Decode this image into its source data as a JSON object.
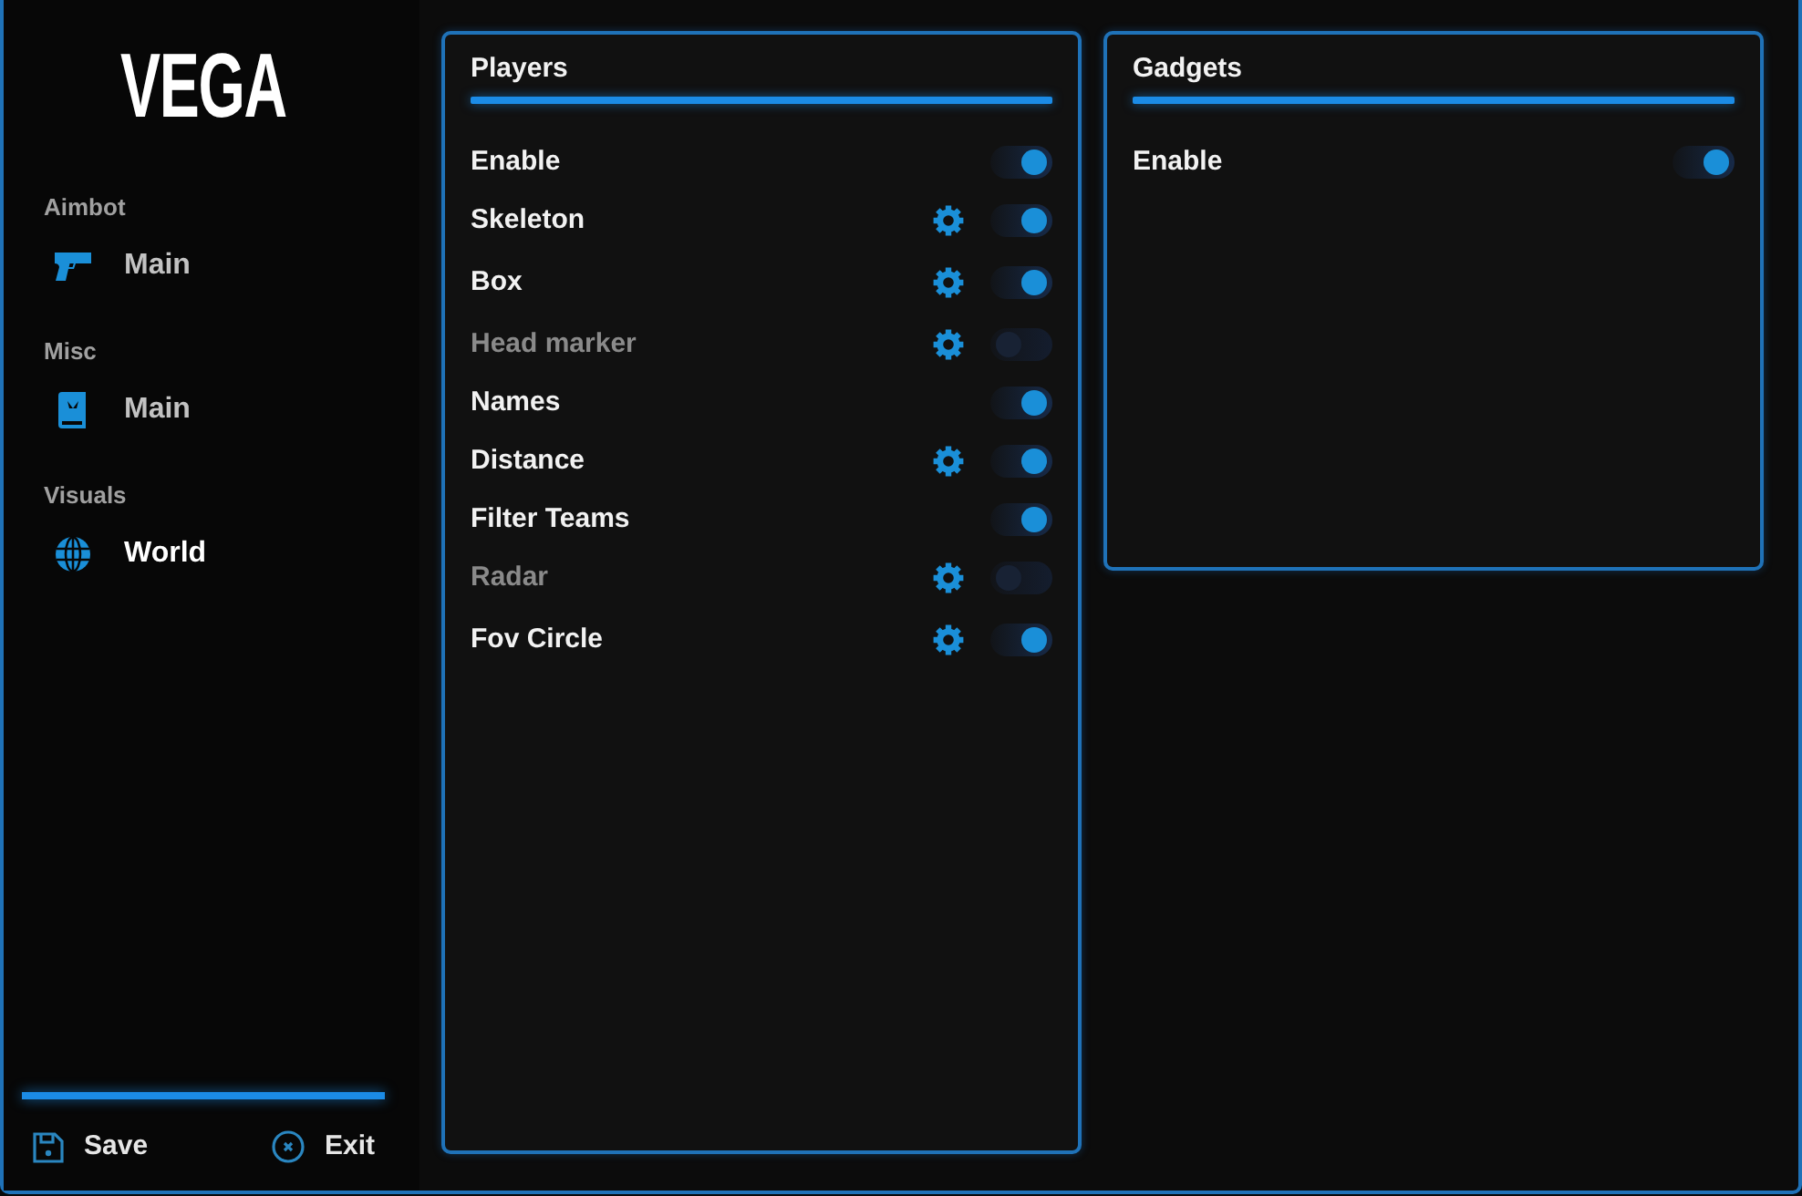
{
  "logo": {
    "text": "VEGA"
  },
  "sidebar": {
    "sections": [
      {
        "label": "Aimbot",
        "items": [
          {
            "label": "Main",
            "selected": false
          }
        ]
      },
      {
        "label": "Misc",
        "items": [
          {
            "label": "Main",
            "selected": false
          }
        ]
      },
      {
        "label": "Visuals",
        "items": [
          {
            "label": "World",
            "selected": true
          }
        ]
      }
    ]
  },
  "footer": {
    "buttons": [
      {
        "label": "Save",
        "kind": "save"
      },
      {
        "label": "Exit",
        "kind": "exit"
      }
    ]
  },
  "panels": [
    {
      "title": "Players",
      "options": [
        {
          "label": "Enable",
          "on": true,
          "settings": false
        },
        {
          "label": "Skeleton",
          "on": true,
          "settings": true
        },
        {
          "label": "Box",
          "on": true,
          "settings": true
        },
        {
          "label": "Head marker",
          "on": false,
          "settings": true
        },
        {
          "label": "Names",
          "on": true,
          "settings": false
        },
        {
          "label": "Distance",
          "on": true,
          "settings": true
        },
        {
          "label": "Filter Teams",
          "on": true,
          "settings": false
        },
        {
          "label": "Radar",
          "on": false,
          "settings": true
        },
        {
          "label": "Fov Circle",
          "on": true,
          "settings": true
        }
      ]
    },
    {
      "title": "Gadgets",
      "options": [
        {
          "label": "Enable",
          "on": true,
          "settings": false
        }
      ]
    }
  ]
}
